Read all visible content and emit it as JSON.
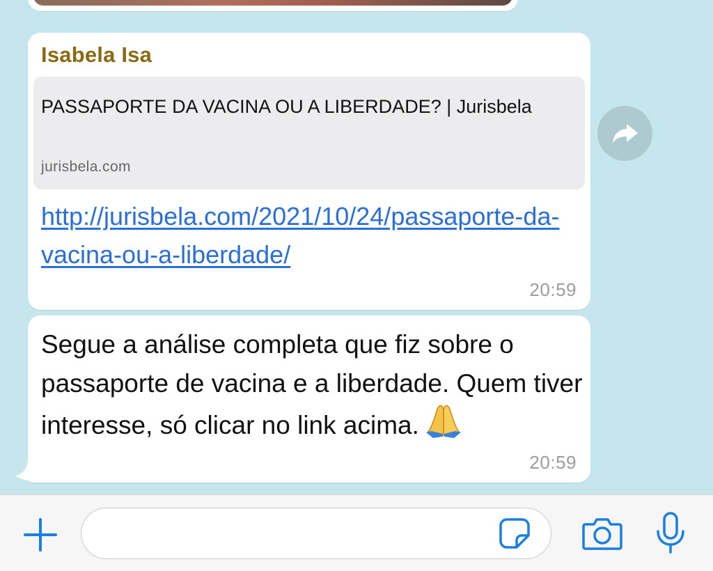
{
  "colors": {
    "chat_background": "#c4e6ec",
    "bubble": "#ffffff",
    "sender_name": "#8a6a12",
    "link": "#2a6fd6",
    "accent_icons": "#1a7fe0",
    "timestamp": "#9c9c9c"
  },
  "messages": [
    {
      "sender": "Isabela Isa",
      "preview": {
        "title": "PASSAPORTE DA VACINA OU A LIBERDADE? | Jurisbela",
        "domain": "jurisbela.com"
      },
      "link": "http://jurisbela.com/2021/10/24/passaporte-da-vacina-ou-a-liberdade/",
      "time": "20:59"
    },
    {
      "text": "Segue a análise completa que fiz sobre o passaporte de vacina e a liberdade. Quem tiver interesse, só clicar no link acima.",
      "emoji": "folded-hands-emoji",
      "time": "20:59"
    }
  ],
  "actions": {
    "forward_icon": "forward-arrow-icon"
  },
  "input_bar": {
    "placeholder": "",
    "icons": [
      "plus-icon",
      "sticker-icon",
      "camera-icon",
      "microphone-icon"
    ]
  }
}
